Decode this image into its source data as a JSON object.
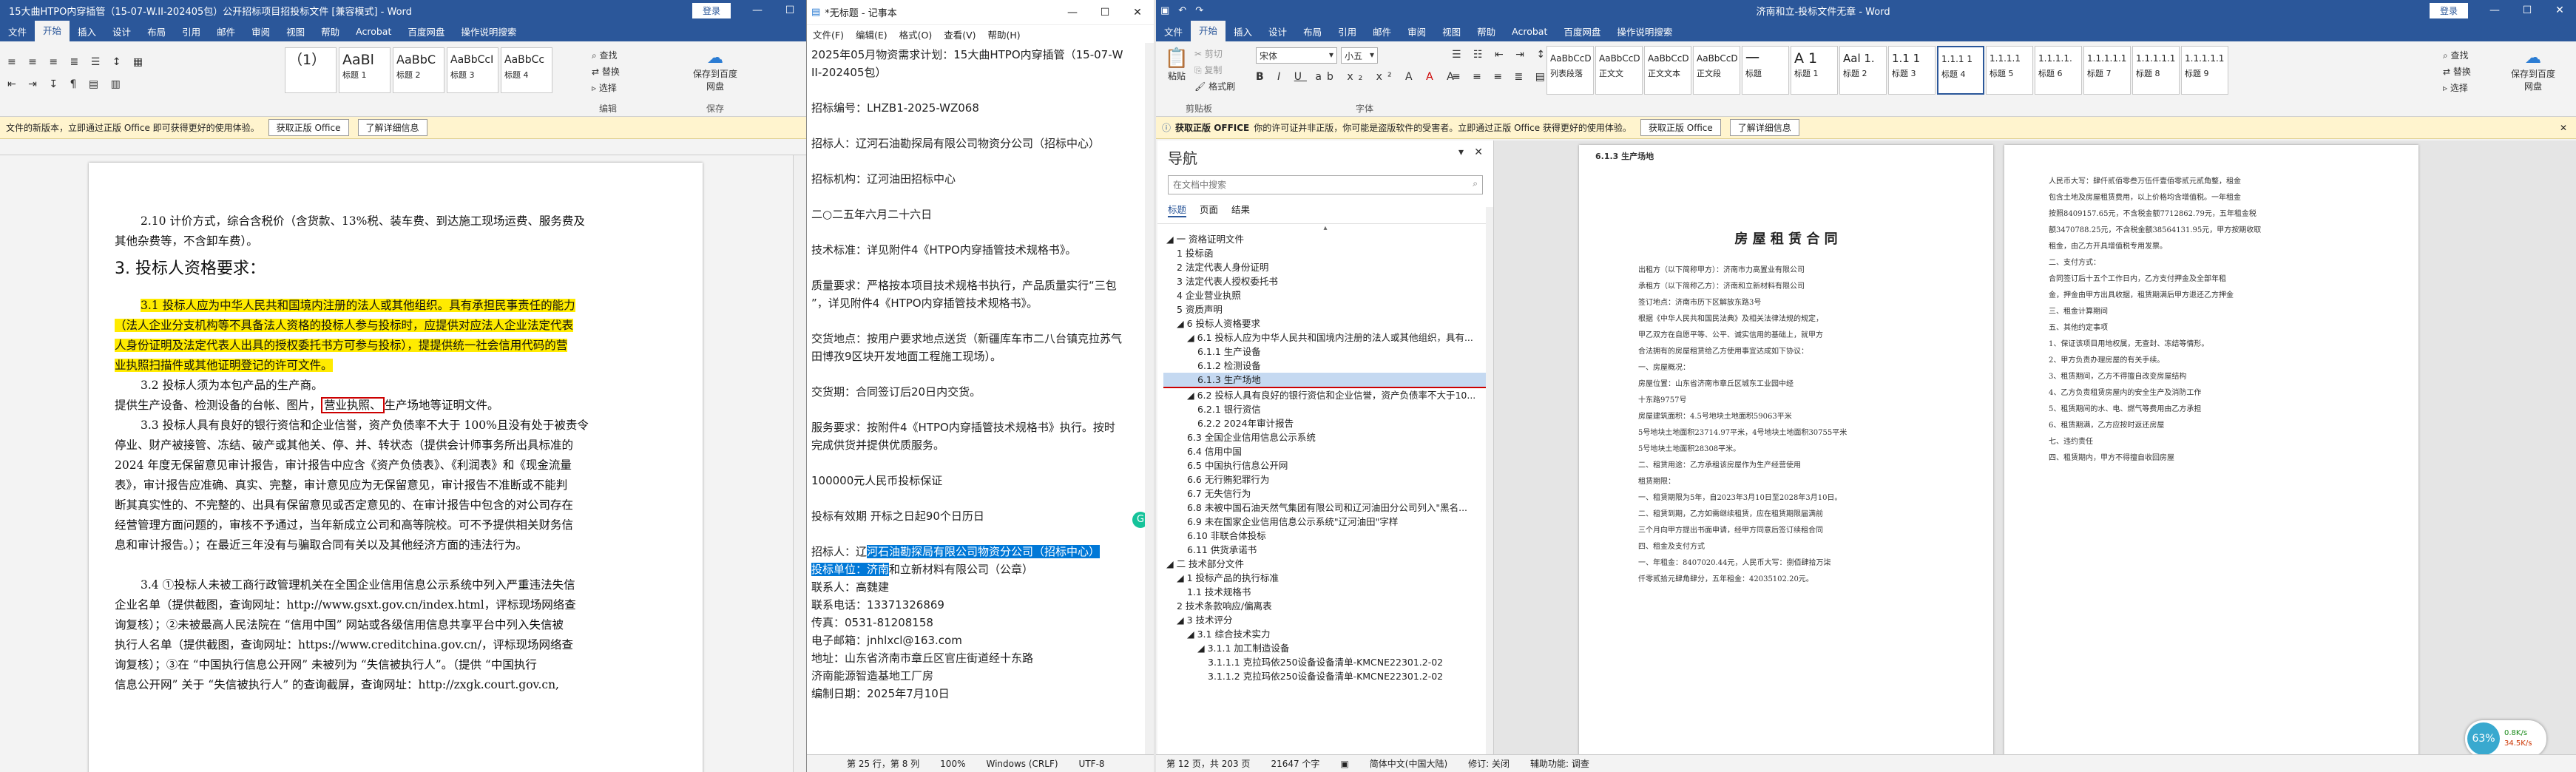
{
  "left_window": {
    "title": "15大曲HTPO内穿插管（15-07-W.II-202405包）公开招标项目招投标文件 [兼容模式] - Word",
    "login": "登录",
    "tabs": [
      "文件",
      "开始",
      "插入",
      "设计",
      "布局",
      "引用",
      "邮件",
      "审阅",
      "视图",
      "帮助",
      "Acrobat",
      "百度网盘",
      "操作说明搜索"
    ],
    "styles": [
      {
        "sample": "（1）",
        "name": ""
      },
      {
        "sample": "AaBl",
        "name": "标题 1"
      },
      {
        "sample": "AaBbC",
        "name": "标题 2"
      },
      {
        "sample": "AaBbCcI",
        "name": "标题 3"
      },
      {
        "sample": "AaBbCc",
        "name": "标题 4"
      }
    ],
    "find": "查找",
    "replace": "替换",
    "select": "选择",
    "editing": "编辑",
    "save_to_pan": "保存到百度网盘",
    "save_group": "保存",
    "message": "文件的新版本，立即通过正版 Office 即可获得更好的使用体验。",
    "msg_btn1": "获取正版 Office",
    "msg_btn2": "了解详细信息",
    "doc": {
      "l1": "2.10 计价方式，综合含税价（含货款、13%税、装车费、到达施工现场运费、服务费及",
      "l2": "其他杂费等，不含卸车费）。",
      "heading": "3. 投标人资格要求：",
      "h1": "3.1 投标人应为中华人民共和国境内注册的法人或其他组织。具有承担民事责任的能力",
      "h2": "（法人企业分支机构等不具备法人资格的投标人参与投标时，应提供对应法人企业法定代表",
      "h3": "人身份证明及法定代表人出具的授权委托书方可参与投标），提提供统一社会信用代码的营",
      "h4": "业执照扫描件或其他证明登记的许可文件。",
      "l3": "3.2 投标人须为本包产品的生产商。",
      "l4a": "提供生产设备、检测设备的台帐、图片，",
      "l4b": "营业执照、",
      "l4c": "生产场地等证明文件。",
      "l5": "3.3 投标人具有良好的银行资信和企业信誉，资产负债率不大于 100%且没有处于被责令",
      "l6": "停业、财产被接管、冻结、破产或其他关、停、并、转状态（提供会计师事务所出具标准的",
      "l7": "2024 年度无保留意见审计报告，审计报告中应含《资产负债表》、《利润表》和《现金流量",
      "l8": "表》，审计报告应准确、真实、完整，审计意见应为无保留意见，审计报告不准断或不能判",
      "l9": "断其真实性的、不完整的、出具有保留意见或否定意见的、在审计报告中包含的对公司存在",
      "l10": "经营管理方面问题的，审核不予通过，当年新成立公司和高等院校。可不予提供相关财务信",
      "l11": "息和审计报告。）；在最近三年没有与骗取合同有关以及其他经济方面的违法行为。",
      "l12": "3.4 ①投标人未被工商行政管理机关在全国企业信用信息公示系统中列入严重违法失信",
      "l13": "企业名单（提供截图，查询网址：http://www.gsxt.gov.cn/index.html，评标现场网络查",
      "l14": "询复核）；②未被最高人民法院在 “信用中国” 网站或各级信用信息共享平台中列入失信被",
      "l15": "执行人名单（提供截图，查询网址：https://www.creditchina.gov.cn/，评标现场网络查",
      "l16": "询复核）；③在 “中国执行信息公开网” 未被列为 “失信被执行人”。（提供 “中国执行",
      "l17": "信息公开网” 关于 “失信被执行人” 的查询截屏，查询网址：http://zxgk.court.gov.cn,"
    }
  },
  "notepad": {
    "title": "*无标题 - 记事本",
    "menu": [
      "文件(F)",
      "编辑(E)",
      "格式(O)",
      "查看(V)",
      "帮助(H)"
    ],
    "lines": [
      "2025年05月物资需求计划：15大曲HTPO内穿插管（15-07-W",
      "II-202405包）",
      "",
      "招标编号：LHZB1-2025-WZ068",
      "",
      "招标人：辽河石油勘探局有限公司物资分公司（招标中心）",
      "",
      "招标机构：辽河油田招标中心",
      "",
      "二○二五年六月二十六日",
      "",
      "技术标准：详见附件4《HTPO内穿插管技术规格书》。",
      "",
      "质量要求：严格按本项目技术规格书执行，产品质量实行“三包",
      "”，详见附件4《HTPO内穿插管技术规格书》。",
      "",
      "交货地点：按用户要求地点送货（新疆库车市二八台镇克拉苏气",
      "田博孜9区块开发地面工程施工现场）。",
      "",
      "交货期：合同签订后20日内交货。",
      "",
      "服务要求：按附件4《HTPO内穿插管技术规格书》执行。按时",
      "完成供货并提供优质服务。",
      "",
      "100000元人民币投标保证",
      "",
      "投标有效期  开标之日起90个日历日",
      ""
    ],
    "sel1a": "招标人：辽",
    "sel1b": "河石油勘探局有限公司物资分公司（招标中心）",
    "sel2a": "投标单位：济南",
    "sel2b": "和立新材料有限公司（公章）",
    "tail": [
      "联系人：高魏建",
      "联系电话：13371326869",
      "传真：0531-81208158",
      "电子邮箱：jnhlxcl@163.com",
      "地址：山东省济南市章丘区官庄街道经十东路",
      "济南能源智造基地工厂房",
      "编制日期：2025年7月10日"
    ],
    "status": [
      "第 25 行，第 8 列",
      "100%",
      "Windows (CRLF)",
      "UTF-8"
    ]
  },
  "right_window": {
    "title": "济南和立-投标文件无章 - Word",
    "login": "登录",
    "tabs": [
      "文件",
      "开始",
      "插入",
      "设计",
      "布局",
      "引用",
      "邮件",
      "审阅",
      "视图",
      "帮助",
      "Acrobat",
      "百度网盘",
      "操作说明搜索"
    ],
    "font_name": "宋体",
    "font_size": "小五",
    "clipboard_label": "剪贴板",
    "font_label": "字体",
    "paste": "粘贴",
    "cut": "剪切",
    "copy": "复制",
    "painter": "格式刷",
    "styles": [
      {
        "sample": "AaBbCcD",
        "name": "列表段落"
      },
      {
        "sample": "AaBbCcD",
        "name": "正文文"
      },
      {
        "sample": "AaBbCcD",
        "name": "正文文本"
      },
      {
        "sample": "AaBbCcD",
        "name": "正文段"
      },
      {
        "sample": "一",
        "name": "标题"
      },
      {
        "sample": "A 1",
        "name": "标题 1"
      },
      {
        "sample": "Aal 1.",
        "name": "标题 2"
      },
      {
        "sample": "1.1 1",
        "name": "标题 3"
      },
      {
        "sample": "1.1.1 1",
        "name": "标题 4"
      },
      {
        "sample": "1.1.1.1",
        "name": "标题 5"
      },
      {
        "sample": "1.1.1.1.",
        "name": "标题 6"
      },
      {
        "sample": "1.1.1.1.1",
        "name": "标题 7"
      },
      {
        "sample": "1.1.1.1.1",
        "name": "标题 8"
      },
      {
        "sample": "1.1.1.1.1",
        "name": "标题 9"
      }
    ],
    "find": "查找",
    "replace": "替换",
    "select": "选择",
    "save_to_pan": "保存到百度网盘",
    "message_label": "获取正版 OFFICE",
    "message": "你的许可证并非正版，你可能是盗版软件的受害者。立即通过正版 Office 获得更好的使用体验。",
    "msg_btn1": "获取正版 Office",
    "msg_btn2": "了解详细信息",
    "nav": {
      "title": "导航",
      "search_placeholder": "在文档中搜索",
      "tabs": [
        "标题",
        "页面",
        "结果"
      ],
      "items": [
        {
          "t": "◢ 一 资格证明文件",
          "lv": 0
        },
        {
          "t": "1 投标函",
          "lv": 1
        },
        {
          "t": "2 法定代表人身份证明",
          "lv": 1
        },
        {
          "t": "3 法定代表人授权委托书",
          "lv": 1
        },
        {
          "t": "4 企业营业执照",
          "lv": 1
        },
        {
          "t": "5 资质声明",
          "lv": 1
        },
        {
          "t": "◢ 6 投标人资格要求",
          "lv": 1
        },
        {
          "t": "◢ 6.1 投标人应为中华人民共和国境内注册的法人或其他组织，具有...",
          "lv": 2
        },
        {
          "t": "6.1.1 生产设备",
          "lv": 3
        },
        {
          "t": "6.1.2 检测设备",
          "lv": 3
        },
        {
          "t": "6.1.3 生产场地",
          "lv": 3
        },
        {
          "t": "◢ 6.2 投标人具有良好的银行资信和企业信誉，资产负债率不大于10...",
          "lv": 2
        },
        {
          "t": "6.2.1 银行资信",
          "lv": 3
        },
        {
          "t": "6.2.2 2024年审计报告",
          "lv": 3
        },
        {
          "t": "6.3 全国企业信用信息公示系统",
          "lv": 2
        },
        {
          "t": "6.4 信用中国",
          "lv": 2
        },
        {
          "t": "6.5 中国执行信息公开网",
          "lv": 2
        },
        {
          "t": "6.6 无行贿犯罪行为",
          "lv": 2
        },
        {
          "t": "6.7 无失信行为",
          "lv": 2
        },
        {
          "t": "6.8 未被中国石油天然气集团有限公司和辽河油田分公司列入\"黑名...",
          "lv": 2
        },
        {
          "t": "6.9 未在国家企业信用信息公示系统\"辽河油田\"字样",
          "lv": 2
        },
        {
          "t": "6.10 非联合体投标",
          "lv": 2
        },
        {
          "t": "6.11 供货承诺书",
          "lv": 2
        },
        {
          "t": "◢ 二 技术部分文件",
          "lv": 0
        },
        {
          "t": "◢ 1 投标产品的执行标准",
          "lv": 1
        },
        {
          "t": "1.1 技术规格书",
          "lv": 2
        },
        {
          "t": "2 技术条款响应/偏离表",
          "lv": 1
        },
        {
          "t": "◢ 3 技术评分",
          "lv": 1
        },
        {
          "t": "◢ 3.1 综合技术实力",
          "lv": 2
        },
        {
          "t": "◢ 3.1.1 加工制造设备",
          "lv": 3
        },
        {
          "t": "3.1.1.1 克拉玛依250设备设备清单-KMCNE22301.2-02",
          "lv": 4
        },
        {
          "t": "3.1.1.2 克拉玛依250设备设备清单-KMCNE22301.2-02",
          "lv": 4
        }
      ],
      "selected": 10
    },
    "page_left": {
      "header": "6.1.3 生产场地",
      "title": "房 屋 租 赁 合 同",
      "lines": [
        "出租方（以下简称甲方）：济南市力高置业有限公司",
        "承租方（以下简称乙方）：济南和立新材料有限公司",
        "签订地点：济南市历下区解放东路3号",
        "根据《中华人民共和国民法典》及相关法律法规的规定，",
        "甲乙双方在自愿平等、公平、诚实信用的基础上，就甲方",
        "合法拥有的房屋租赁给乙方使用事宜达成如下协议：",
        "一、房屋概况：",
        "房屋位置：山东省济南市章丘区城东工业园中经",
        "十东路9757号",
        "房屋建筑面积：4.5号地块土地面积59063平米",
        "5号地块土地面积23714.97平米，4号地块土地面积30755平米",
        "5号地块土地面积28308平米。",
        "二、租赁用途：乙方承租该房屋作为生产经营使用",
        "租赁期限：",
        "一、租赁期限为5年，自2023年3月10日至2028年3月10日。",
        "二、租赁到期，乙方如需继续租赁，应在租赁期限届满前",
        "三个月向甲方提出书面申请，经甲方同意后签订续租合同",
        "四、租金及支付方式",
        "一、年租金：8407020.44元，人民币大写：捌佰肆拾万柒",
        "仟零贰拾元肆角肆分，五年租金：42035102.20元。"
      ]
    },
    "page_right": {
      "lines": [
        "人民币大写：肆仟贰佰零叁万伍仟壹佰零贰元贰角整，租金",
        "包含土地及房屋租赁费用，以上价格均含增值税。一年租金",
        "按照8409157.65元，不含税金额7712862.79元，五年租金税",
        "额3470788.25元，不含税金额38564131.95元，甲方按期收取",
        "租金，由乙方开具增值税专用发票。",
        "二、支付方式：",
        "合同签订后十五个工作日内，乙方支付押金及全部年租",
        "金，押金由甲方出具收据，租赁期满后甲方退还乙方押金",
        "三、租金计算期间",
        "五、其他约定事项",
        "1、保证该项目用地权属，无查封、冻结等情形。",
        "2、甲方负责办理房屋的有关手续。",
        "3、租赁期间，乙方不得擅自改变房屋结构",
        "4、乙方负责租赁房屋内的安全生产及消防工作",
        "5、租赁期间的水、电、燃气等费用由乙方承担",
        "6、租赁期满，乙方应按时返还房屋",
        "七、违约责任",
        "四、租赁期内，甲方不得擅自收回房屋"
      ]
    },
    "status": [
      "第 12 页，共 203 页",
      "21647 个字",
      "简体中文(中国大陆)",
      "修订: 关闭",
      "辅助功能: 调查"
    ],
    "zoom": "63%",
    "speed1": "0.8K/s",
    "speed2": "34.5K/s"
  }
}
